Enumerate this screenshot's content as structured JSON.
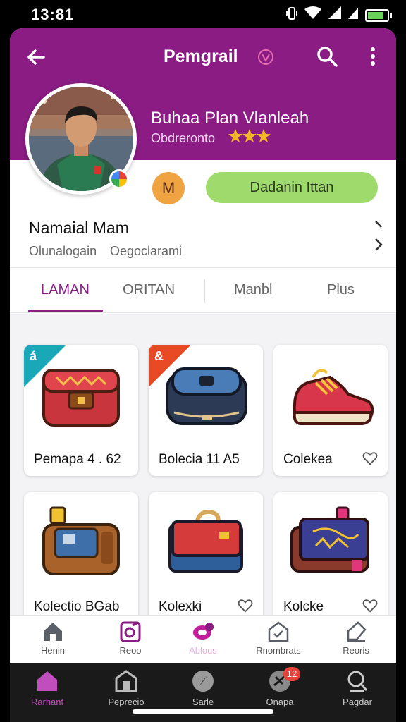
{
  "status_bar": {
    "time": "13:81",
    "icons": [
      "vibrate-icon",
      "wifi-icon",
      "signal-icon",
      "signal-icon",
      "battery-icon"
    ]
  },
  "header": {
    "title": "Pemgrail",
    "profile_name": "Buhaa Plan Vlanleah",
    "profile_sub": "Obdreronto",
    "level_badge": "M",
    "action_button": "Dadanin Ittan",
    "colors": {
      "header_bg": "#8a1c84",
      "action_bg": "#9fdb6c",
      "level_bg": "#f0a341",
      "stars": "#f2b728"
    }
  },
  "info_row": {
    "title": "Namaial Mam",
    "sub_left": "Olunalogain",
    "sub_right": "Oegoclarami"
  },
  "tabs": [
    {
      "label": "LAMAN",
      "active": true
    },
    {
      "label": "ORITAN",
      "active": false
    },
    {
      "label": "Manbl",
      "active": false
    },
    {
      "label": "Plus",
      "active": false
    }
  ],
  "items": [
    {
      "label": "Pemapa 4 . 62",
      "ribbon": "teal",
      "ribbon_glyph": "á"
    },
    {
      "label": "Bolecia 11 A5",
      "ribbon": "red",
      "ribbon_glyph": "&"
    },
    {
      "label": "Colekea",
      "favorite_icon": "heart-icon"
    },
    {
      "label": "Kolectio BGab"
    },
    {
      "label": "Kolexki",
      "favorite_icon": "heart-icon"
    },
    {
      "label": "Kolcke",
      "favorite_icon": "heart-icon"
    }
  ],
  "bottom_nav": [
    {
      "label": "Henin",
      "icon": "home-icon"
    },
    {
      "label": "Reoo",
      "icon": "edit-icon"
    },
    {
      "label": "Ablous",
      "icon": "chat-icon"
    },
    {
      "label": "Rnombrats",
      "icon": "checklist-icon"
    },
    {
      "label": "Reoris",
      "icon": "tag-icon"
    }
  ],
  "system_nav": [
    {
      "label": "Rarhant",
      "icon": "home-icon",
      "active": true
    },
    {
      "label": "Peprecio",
      "icon": "store-icon"
    },
    {
      "label": "Sarle",
      "icon": "compass-icon"
    },
    {
      "label": "Onapa",
      "icon": "clover-icon",
      "badge": "12"
    },
    {
      "label": "Pagdar",
      "icon": "search-icon"
    }
  ]
}
